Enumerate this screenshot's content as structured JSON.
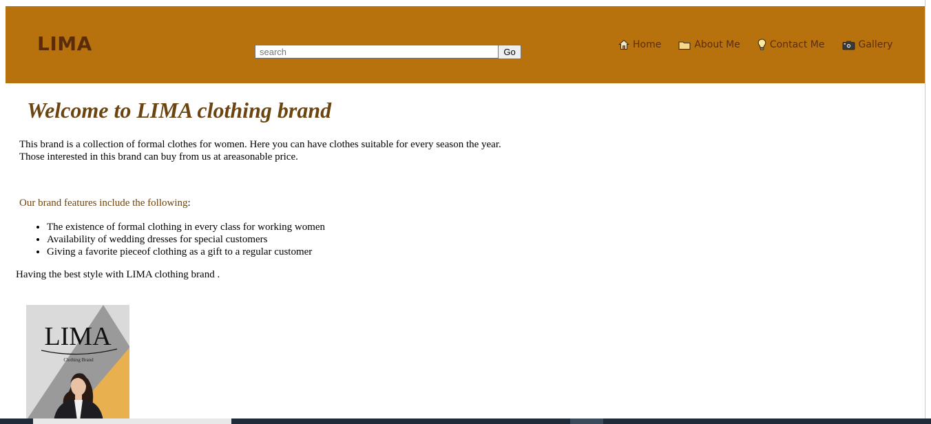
{
  "header": {
    "logo": "LIMA",
    "search_placeholder": "search",
    "search_button": "Go",
    "nav": [
      {
        "label": "Home",
        "icon": "home-icon"
      },
      {
        "label": "About Me",
        "icon": "folder-icon"
      },
      {
        "label": "Contact Me",
        "icon": "lightbulb-icon"
      },
      {
        "label": "Gallery",
        "icon": "camera-icon"
      }
    ]
  },
  "main": {
    "title": "Welcome to LIMA clothing brand",
    "intro_line1": "This brand is a collection of formal clothes for women. Here you can have clothes suitable for every season the year.",
    "intro_line2": "Those interested in this brand can buy from us at areasonable price.",
    "features_heading": "Our brand features include the following",
    "features_colon": ":",
    "features": [
      "The existence of formal clothing in every class for working women",
      "Availability of wedding dresses for special customers",
      "Giving a favorite pieceof clothing as a gift to a regular customer"
    ],
    "closing": "Having the best style with LIMA clothing brand ."
  },
  "brand_image": {
    "logo_text": "LIMA",
    "subtitle": "Clothing Brand"
  },
  "colors": {
    "header_bg": "#b8720d",
    "logo": "#5a2c0a",
    "title": "#6b4410"
  }
}
